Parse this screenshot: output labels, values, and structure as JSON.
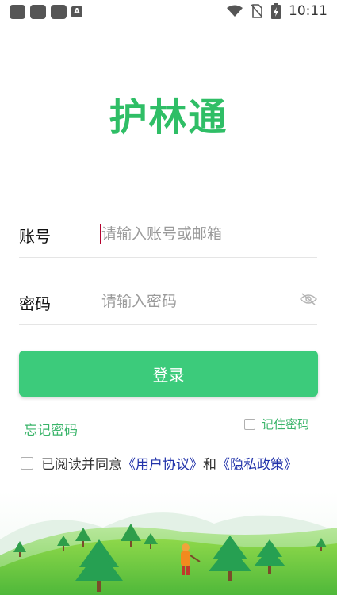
{
  "status_bar": {
    "time": "10:11"
  },
  "app": {
    "title": "护林通"
  },
  "form": {
    "account_label": "账号",
    "account_placeholder": "请输入账号或邮箱",
    "password_label": "密码",
    "password_placeholder": "请输入密码",
    "login_button": "登录",
    "forgot_password": "忘记密码",
    "remember_password": "记住密码",
    "agree_prefix": "已阅读并同意",
    "user_agreement": "《用户协议》",
    "agree_and": "和",
    "privacy_policy": "《隐私政策》"
  },
  "colors": {
    "brand_green": "#2fbe66",
    "button_green": "#3ccb7b",
    "link_blue": "#2233aa"
  },
  "icons": [
    "wifi-icon",
    "no-sim-icon",
    "battery-icon",
    "eye-off-icon",
    "checkbox-icon"
  ]
}
